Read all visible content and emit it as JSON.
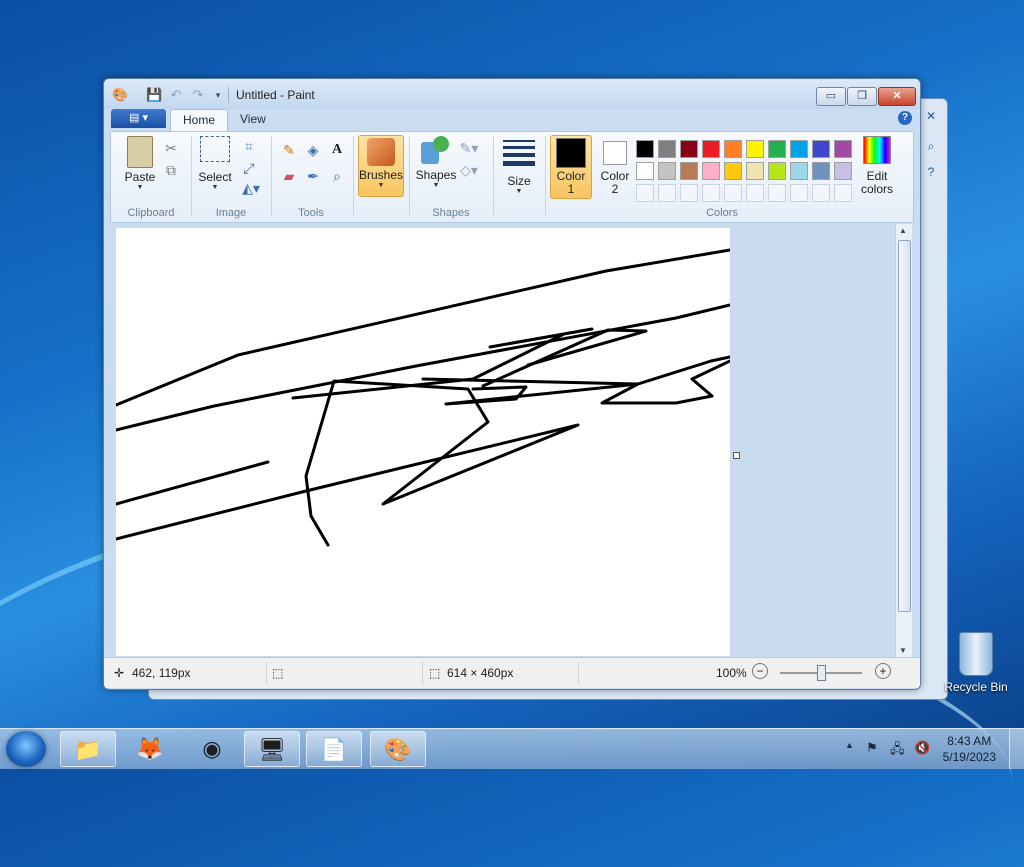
{
  "window": {
    "title": "Untitled - Paint",
    "minimize_label": "▭",
    "restore_label": "❐",
    "close_label": "✕"
  },
  "tabs": {
    "file_label": "▤ ▾",
    "home": "Home",
    "view": "View"
  },
  "ribbon": {
    "clipboard": {
      "label": "Clipboard",
      "paste": "Paste"
    },
    "image": {
      "label": "Image",
      "select": "Select"
    },
    "tools": {
      "label": "Tools"
    },
    "brushes": "Brushes",
    "shapes": {
      "label": "Shapes",
      "button": "Shapes"
    },
    "size": "Size",
    "color1": [
      "Color",
      "1"
    ],
    "color2": [
      "Color",
      "2"
    ],
    "colors_label": "Colors",
    "edit_colors": [
      "Edit",
      "colors"
    ],
    "color1_value": "#000000",
    "color2_value": "#ffffff",
    "palette_row1": [
      "#000000",
      "#7f7f7f",
      "#880015",
      "#ed1c24",
      "#ff7f27",
      "#fff200",
      "#22b14c",
      "#00a2e8",
      "#3f48cc",
      "#a349a4"
    ],
    "palette_row2": [
      "#ffffff",
      "#c3c3c3",
      "#b97a57",
      "#ffaec9",
      "#ffc90e",
      "#efe4b0",
      "#b5e61d",
      "#99d9ea",
      "#7092be",
      "#c8bfe7"
    ]
  },
  "status": {
    "cursor_pos": "462, 119px",
    "canvas_size": "614 × 460px",
    "zoom": "100%"
  },
  "taskbar": {
    "time": "8:43 AM",
    "date": "5/19/2023"
  },
  "desktop": {
    "recycle_bin": "Recycle Bin"
  },
  "drawing": {
    "stroke_color": "#000000",
    "strokes": [
      "0,177 122,127 490,43 614,22",
      "0,202 98,178 300,138 560,90 614,77",
      "0,276 152,234",
      "0,311 190,263 462,197 267,276 372,194 352,161 218,153 190,248 195,288 212,317",
      "177,170 357,151 448,106 374,119 476,101",
      "367,158 492,102 530,103 412,137",
      "307,151 522,156 595,133 614,129",
      "357,161 410,159 400,171 330,176 522,156",
      "614,133 576,151 596,168 560,175 486,175 522,156"
    ]
  }
}
